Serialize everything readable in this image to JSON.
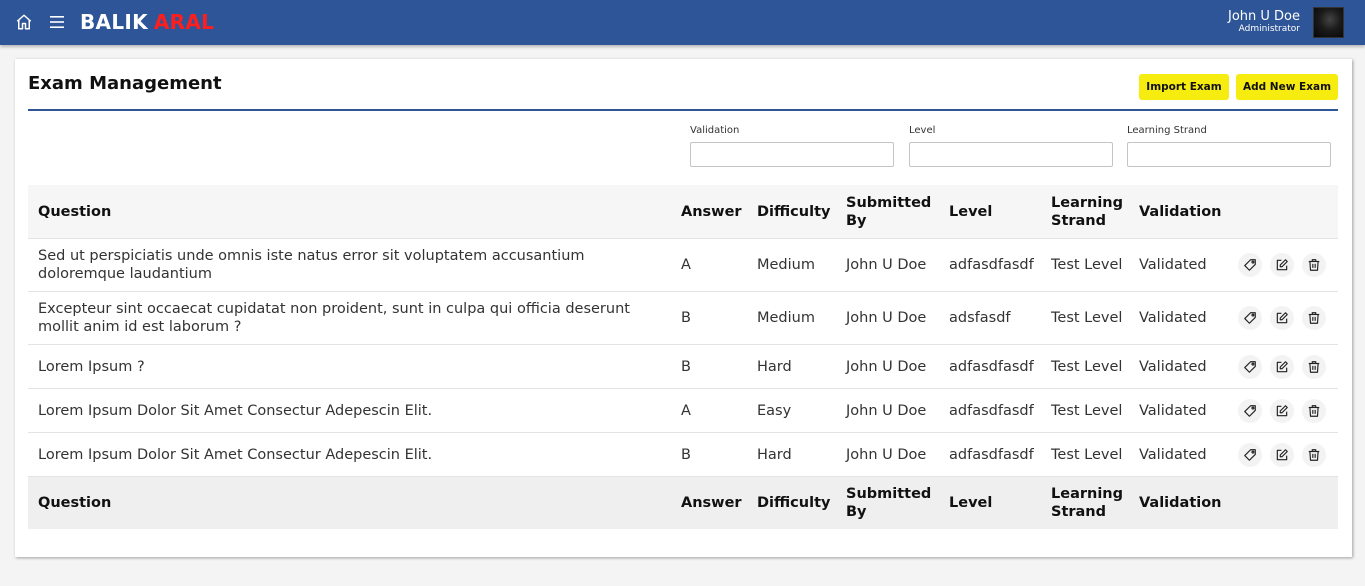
{
  "header": {
    "brand_part1": "BALIK",
    "brand_part2": "ARAL",
    "user_name": "John U Doe",
    "user_role": "Administrator"
  },
  "page": {
    "title": "Exam Management",
    "import_label": "Import Exam",
    "add_label": "Add New Exam"
  },
  "filters": [
    {
      "label": "Validation",
      "value": ""
    },
    {
      "label": "Level",
      "value": ""
    },
    {
      "label": "Learning Strand",
      "value": ""
    }
  ],
  "table": {
    "columns": [
      "Question",
      "Answer",
      "Difficulty",
      "Submitted By",
      "Level",
      "Learning Strand",
      "Validation"
    ],
    "rows": [
      {
        "question": "Sed ut perspiciatis unde omnis iste natus error sit voluptatem accusantium doloremque laudantium",
        "answer": "A",
        "difficulty": "Medium",
        "submitted_by": "John U Doe",
        "level": "adfasdfasdf",
        "learning_strand": "Test Level",
        "validation": "Validated"
      },
      {
        "question": "Excepteur sint occaecat cupidatat non proident, sunt in culpa qui officia deserunt mollit anim id est laborum ?",
        "answer": "B",
        "difficulty": "Medium",
        "submitted_by": "John U Doe",
        "level": "adsfasdf",
        "learning_strand": "Test Level",
        "validation": "Validated"
      },
      {
        "question": "Lorem Ipsum ?",
        "answer": "B",
        "difficulty": "Hard",
        "submitted_by": "John U Doe",
        "level": "adfasdfasdf",
        "learning_strand": "Test Level",
        "validation": "Validated"
      },
      {
        "question": "Lorem Ipsum Dolor Sit Amet Consectur Adepescin Elit.",
        "answer": "A",
        "difficulty": "Easy",
        "submitted_by": "John U Doe",
        "level": "adfasdfasdf",
        "learning_strand": "Test Level",
        "validation": "Validated"
      },
      {
        "question": "Lorem Ipsum Dolor Sit Amet Consectur Adepescin Elit.",
        "answer": "B",
        "difficulty": "Hard",
        "submitted_by": "John U Doe",
        "level": "adfasdfasdf",
        "learning_strand": "Test Level",
        "validation": "Validated"
      }
    ]
  },
  "icons": {
    "home": "home-icon",
    "menu": "hamburger-menu-icon",
    "tag": "tag-icon",
    "edit": "edit-icon",
    "delete": "trash-icon"
  },
  "colors": {
    "header_bg": "#2e5597",
    "brand_accent": "#ff1e1e",
    "button_yellow": "#f7ec0f"
  }
}
